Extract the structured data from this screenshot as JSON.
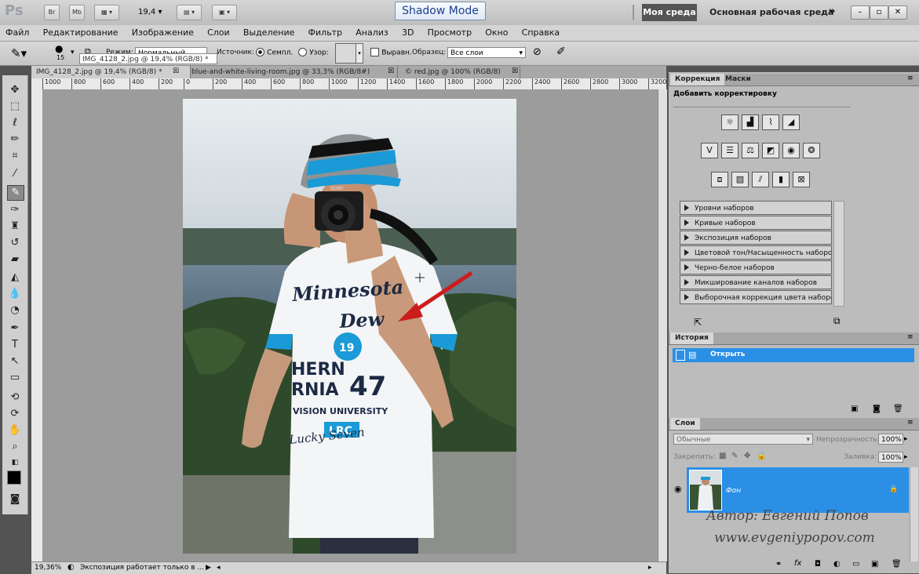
{
  "app": {
    "logo": "Ps",
    "bridge_label": "Br",
    "mini_bridge_label": "Mb",
    "zoom_value": "19,4",
    "shadow_mode": "Shadow Mode",
    "workspace_active": "Моя среда",
    "workspace_main": "Основная рабочая среда",
    "more": "»"
  },
  "menu": [
    "Файл",
    "Редактирование",
    "Изображение",
    "Слои",
    "Выделение",
    "Фильтр",
    "Анализ",
    "3D",
    "Просмотр",
    "Окно",
    "Справка"
  ],
  "options": {
    "brush_size": "15",
    "mode_label": "Режим:",
    "mode_value": "Нормальный",
    "source_label": "Источник:",
    "sample_label": "Семпл.",
    "pattern_label": "Узор:",
    "aligned_label": "Выравн.",
    "sample_from_label": "Образец:",
    "sample_from_value": "Все слои",
    "tooltip": "IMG_4128_2.jpg @ 19,4% (RGB/8) *"
  },
  "tabs": [
    {
      "label": "IMG_4128_2.jpg @ 19,4% (RGB/8) *"
    },
    {
      "label": "blue-and-white-living-room.jpg @ 33,3% (RGB/8#)"
    },
    {
      "label": "© red.jpg @ 100% (RGB/8)"
    }
  ],
  "ruler_ticks": [
    "1000",
    "800",
    "600",
    "400",
    "200",
    "0",
    "200",
    "400",
    "600",
    "800",
    "1000",
    "1200",
    "1400",
    "1600",
    "1800",
    "2000",
    "2200",
    "2400",
    "2600",
    "2800",
    "3000",
    "3200"
  ],
  "status": {
    "zoom": "19,36%",
    "message": "Экспозиция работает только в ..."
  },
  "adjustments": {
    "tab_active": "Коррекция",
    "tab_other": "Маски",
    "title": "Добавить корректировку",
    "presets": [
      "Уровни наборов",
      "Кривые наборов",
      "Экспозиция наборов",
      "Цветовой тон/Насыщенность наборов",
      "Черно-белое наборов",
      "Микширование каналов наборов",
      "Выборочная коррекция цвета наборов"
    ]
  },
  "history": {
    "tab": "История",
    "items": [
      "Открыть"
    ]
  },
  "layers": {
    "tab": "Слои",
    "blend_mode": "Обычные",
    "opacity_label": "Непрозрачность:",
    "opacity_value": "100%",
    "lock_label": "Закрепить:",
    "fill_label": "Заливка:",
    "fill_value": "100%",
    "layer_name": "Фон"
  },
  "watermark": {
    "author": "Автор: Евгений Попов",
    "url": "www.evgeniypopov.com"
  },
  "photo": {
    "shirt_text_1": "Minnesota",
    "shirt_text_2": "Dew",
    "shirt_number_badge": "19",
    "shirt_text_3": "HERN",
    "shirt_text_4": "RNIA",
    "shirt_number": "47",
    "shirt_text_5": "VISION UNIVERSITY",
    "shirt_text_6": "LRC",
    "shirt_text_7": "Lucky Seven",
    "camera_brand": "SONY"
  },
  "colors": {
    "accent_blue": "#2b8fe6",
    "arrow_red": "#cc1d1d",
    "cap_blue": "#1a9ad6"
  }
}
